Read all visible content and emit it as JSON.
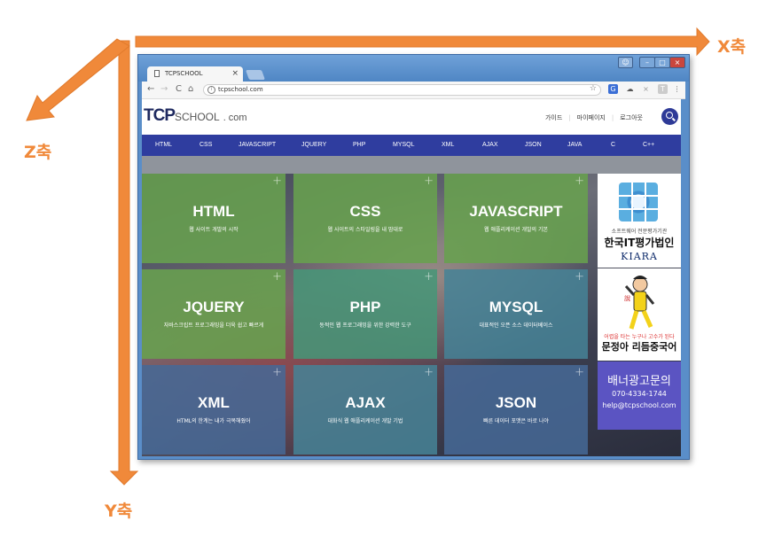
{
  "axes": {
    "x_label": "X축",
    "y_label": "Y축",
    "z_label": "Z축",
    "arrow_color": "#f0893a"
  },
  "browser": {
    "tab_title": "TCPSCHOOL",
    "tab_close": "×",
    "url": "tcpschool.com",
    "controls": {
      "minimize": "–",
      "maximize": "□",
      "close": "×"
    },
    "nav": {
      "back": "←",
      "forward": "→",
      "reload": "C",
      "home": "⌂"
    },
    "icons": {
      "info": "i",
      "star": "☆",
      "menu": "⋮"
    }
  },
  "site": {
    "logo": {
      "tcp": "TCP",
      "school": "SCHOOL",
      "domain": ". com"
    },
    "header_links": [
      "가이드",
      "마이페이지",
      "로그아웃"
    ],
    "menu": [
      "HTML",
      "CSS",
      "JAVASCRIPT",
      "JQUERY",
      "PHP",
      "MYSQL",
      "XML",
      "AJAX",
      "JSON",
      "JAVA",
      "C",
      "C++"
    ],
    "tiles": [
      {
        "title": "HTML",
        "subtitle": "웹 사이트 개발의 시작"
      },
      {
        "title": "CSS",
        "subtitle": "웹 사이트의 스타일링을 내 맘대로"
      },
      {
        "title": "JAVASCRIPT",
        "subtitle": "웹 애플리케이션 개발의 기본"
      },
      {
        "title": "JQUERY",
        "subtitle": "자바스크립트 프로그래밍을 더욱 쉽고 빠르게"
      },
      {
        "title": "PHP",
        "subtitle": "동적인 웹 프로그래밍을 위한 강력한 도구"
      },
      {
        "title": "MYSQL",
        "subtitle": "대표적인 오픈 소스 데이터베이스"
      },
      {
        "title": "XML",
        "subtitle": "HTML의 한계는 내가 극복해줬어"
      },
      {
        "title": "AJAX",
        "subtitle": "대화식 웹 애플리케이션 개발 기법"
      },
      {
        "title": "JSON",
        "subtitle": "빠른 데이터 포맷은 바로 나야"
      }
    ],
    "tile_plus": "+",
    "ads": {
      "kiara_sub": "소프트웨어 전문평가기관",
      "kiara_main": "한국IT평가법인",
      "kiara_brand": "KIARA",
      "chinese_sub": "어렵을 타는 누구나 고수가 된다",
      "chinese_main": "문정아 리듬중국어",
      "contact_main": "배너광고문의",
      "contact_phone": "070-4334-1744",
      "contact_email": "help@tcpschool.com"
    }
  }
}
